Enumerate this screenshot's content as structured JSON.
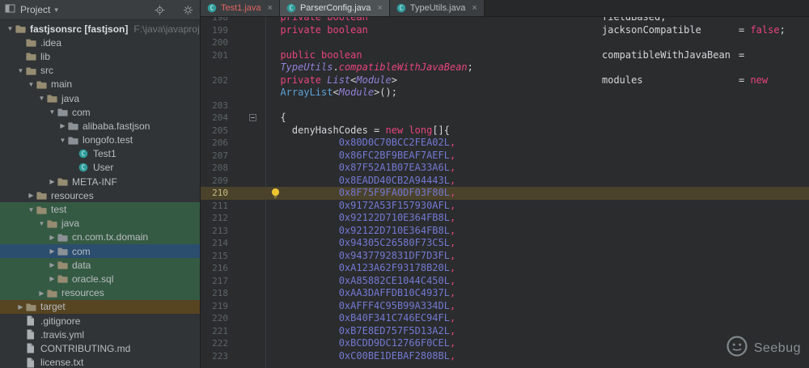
{
  "project_panel": {
    "title": "Project",
    "tool_window_icon": "project-tool-window-icon",
    "header_icons": [
      "locate-icon",
      "collapse-all-icon",
      "gear-icon"
    ],
    "tree": [
      {
        "level": 0,
        "arrow": "down",
        "icon": "folder-icon",
        "label": "fastjsonsrc [fastjson]",
        "extra": "F:\\java\\javaproject\\fastj",
        "bold": true
      },
      {
        "level": 1,
        "arrow": "",
        "icon": "folder-icon",
        "label": ".idea"
      },
      {
        "level": 1,
        "arrow": "",
        "icon": "folder-icon",
        "label": "lib"
      },
      {
        "level": 1,
        "arrow": "down",
        "icon": "folder-icon",
        "label": "src"
      },
      {
        "level": 2,
        "arrow": "down",
        "icon": "folder-icon",
        "label": "main"
      },
      {
        "level": 3,
        "arrow": "down",
        "icon": "folder-icon",
        "label": "java"
      },
      {
        "level": 4,
        "arrow": "down",
        "icon": "package-icon",
        "label": "com"
      },
      {
        "level": 5,
        "arrow": "right",
        "icon": "package-icon",
        "label": "alibaba.fastjson"
      },
      {
        "level": 5,
        "arrow": "down",
        "icon": "package-icon",
        "label": "longofo.test"
      },
      {
        "level": 6,
        "arrow": "",
        "icon": "class-icon",
        "label": "Test1"
      },
      {
        "level": 6,
        "arrow": "",
        "icon": "class-icon",
        "label": "User"
      },
      {
        "level": 4,
        "arrow": "right",
        "icon": "folder-icon",
        "label": "META-INF"
      },
      {
        "level": 2,
        "arrow": "right",
        "icon": "folder-icon",
        "label": "resources"
      },
      {
        "level": 2,
        "arrow": "down",
        "icon": "folder-icon",
        "label": "test",
        "bg": "green"
      },
      {
        "level": 3,
        "arrow": "down",
        "icon": "folder-icon",
        "label": "java",
        "bg": "green"
      },
      {
        "level": 4,
        "arrow": "right",
        "icon": "package-icon",
        "label": "cn.com.tx.domain",
        "bg": "green"
      },
      {
        "level": 4,
        "arrow": "right",
        "icon": "package-icon",
        "label": "com",
        "bg": "blue"
      },
      {
        "level": 4,
        "arrow": "right",
        "icon": "folder-icon",
        "label": "data",
        "bg": "green"
      },
      {
        "level": 4,
        "arrow": "right",
        "icon": "folder-icon",
        "label": "oracle.sql",
        "bg": "green"
      },
      {
        "level": 3,
        "arrow": "right",
        "icon": "folder-icon",
        "label": "resources",
        "bg": "green"
      },
      {
        "level": 1,
        "arrow": "right",
        "icon": "folder-icon",
        "label": "target",
        "bg": "amber"
      },
      {
        "level": 1,
        "arrow": "",
        "icon": "file-icon",
        "label": ".gitignore"
      },
      {
        "level": 1,
        "arrow": "",
        "icon": "file-icon",
        "label": ".travis.yml"
      },
      {
        "level": 1,
        "arrow": "",
        "icon": "file-icon",
        "label": "CONTRIBUTING.md"
      },
      {
        "level": 1,
        "arrow": "",
        "icon": "file-icon",
        "label": "license.txt"
      }
    ]
  },
  "editor": {
    "tabs": [
      {
        "label": "Test1.java",
        "icon": "class-icon",
        "state": "error",
        "close": "×"
      },
      {
        "label": "ParserConfig.java",
        "icon": "class-icon",
        "state": "active",
        "close": "×"
      },
      {
        "label": "TypeUtils.java",
        "icon": "class-icon",
        "state": "normal",
        "close": "×"
      }
    ],
    "lines": [
      {
        "num": "198",
        "segs": [
          [
            "  ",
            "pln"
          ],
          [
            "private boolean",
            "kw"
          ]
        ],
        "col2": [
          [
            "fieldBased;",
            "pln"
          ]
        ]
      },
      {
        "num": "199",
        "segs": [
          [
            "  ",
            "pln"
          ],
          [
            "private boolean",
            "kw"
          ]
        ],
        "col2": [
          [
            "jacksonCompatible",
            "pln"
          ]
        ],
        "col3": [
          [
            "= ",
            "pln"
          ],
          [
            "false",
            "kw"
          ],
          [
            ";",
            "pln"
          ]
        ]
      },
      {
        "num": "200",
        "segs": []
      },
      {
        "num": "201",
        "segs": [
          [
            "  ",
            "pln"
          ],
          [
            "public boolean",
            "kw"
          ]
        ],
        "col2": [
          [
            "compatibleWithJavaBean",
            "pln"
          ]
        ],
        "col3": [
          [
            "=",
            "pln"
          ]
        ]
      },
      {
        "num": "",
        "segs": [
          [
            "  ",
            "pln"
          ],
          [
            "TypeUtils",
            "typ"
          ],
          [
            ".",
            "pln"
          ],
          [
            "compatibleWithJavaBean",
            "kwi"
          ],
          [
            ";",
            "pln"
          ]
        ]
      },
      {
        "num": "202",
        "segs": [
          [
            "  ",
            "pln"
          ],
          [
            "private ",
            "kw"
          ],
          [
            "List",
            "typ"
          ],
          [
            "<",
            "pln"
          ],
          [
            "Module",
            "typ"
          ],
          [
            ">",
            "pln"
          ]
        ],
        "col2": [
          [
            "modules",
            "pln"
          ]
        ],
        "col3": [
          [
            "= ",
            "pln"
          ],
          [
            "new",
            "kw"
          ]
        ]
      },
      {
        "num": "",
        "segs": [
          [
            "  ",
            "pln"
          ],
          [
            "ArrayList",
            "cls"
          ],
          [
            "<",
            "pln"
          ],
          [
            "Module",
            "typ"
          ],
          [
            ">();",
            "pln"
          ]
        ]
      },
      {
        "num": "203",
        "segs": []
      },
      {
        "num": "204",
        "fold": true,
        "segs": [
          [
            "  {",
            "pln"
          ]
        ]
      },
      {
        "num": "205",
        "segs": [
          [
            "    ",
            "pln"
          ],
          [
            "denyHashCodes",
            "pln"
          ],
          [
            " = ",
            "pln"
          ],
          [
            "new ",
            "kw"
          ],
          [
            "long",
            "kw"
          ],
          [
            "[]{",
            "pln"
          ]
        ]
      },
      {
        "num": "206",
        "segs": [
          [
            "            ",
            "pln"
          ],
          [
            "0x80D0C70BCC2FEA02L",
            "num"
          ],
          [
            ",",
            "com"
          ]
        ]
      },
      {
        "num": "207",
        "segs": [
          [
            "            ",
            "pln"
          ],
          [
            "0x86FC2BF9BEAF7AEFL",
            "num"
          ],
          [
            ",",
            "com"
          ]
        ]
      },
      {
        "num": "208",
        "segs": [
          [
            "            ",
            "pln"
          ],
          [
            "0x87F52A1B07EA33A6L",
            "num"
          ],
          [
            ",",
            "com"
          ]
        ]
      },
      {
        "num": "209",
        "segs": [
          [
            "            ",
            "pln"
          ],
          [
            "0x8EADD40CB2A94443L",
            "num"
          ],
          [
            ",",
            "com"
          ]
        ]
      },
      {
        "num": "210",
        "hl": true,
        "bulb": true,
        "segs": [
          [
            "            ",
            "pln"
          ],
          [
            "0x8F75F9FA0DF03F80L",
            "num"
          ],
          [
            ",",
            "com"
          ]
        ]
      },
      {
        "num": "211",
        "segs": [
          [
            "            ",
            "pln"
          ],
          [
            "0x9172A53F157930AFL",
            "num"
          ],
          [
            ",",
            "com"
          ]
        ]
      },
      {
        "num": "212",
        "segs": [
          [
            "            ",
            "pln"
          ],
          [
            "0x92122D710E364FB8L",
            "num"
          ],
          [
            ",",
            "com"
          ]
        ]
      },
      {
        "num": "213",
        "segs": [
          [
            "            ",
            "pln"
          ],
          [
            "0x92122D710E364FB8L",
            "num"
          ],
          [
            ",",
            "com"
          ]
        ]
      },
      {
        "num": "214",
        "segs": [
          [
            "            ",
            "pln"
          ],
          [
            "0x94305C26580F73C5L",
            "num"
          ],
          [
            ",",
            "com"
          ]
        ]
      },
      {
        "num": "215",
        "segs": [
          [
            "            ",
            "pln"
          ],
          [
            "0x9437792831DF7D3FL",
            "num"
          ],
          [
            ",",
            "com"
          ]
        ]
      },
      {
        "num": "216",
        "segs": [
          [
            "            ",
            "pln"
          ],
          [
            "0xA123A62F93178B20L",
            "num"
          ],
          [
            ",",
            "com"
          ]
        ]
      },
      {
        "num": "217",
        "segs": [
          [
            "            ",
            "pln"
          ],
          [
            "0xA85882CE1044C450L",
            "num"
          ],
          [
            ",",
            "com"
          ]
        ]
      },
      {
        "num": "218",
        "segs": [
          [
            "            ",
            "pln"
          ],
          [
            "0xAA3DAFFDB10C4937L",
            "num"
          ],
          [
            ",",
            "com"
          ]
        ]
      },
      {
        "num": "219",
        "segs": [
          [
            "            ",
            "pln"
          ],
          [
            "0xAFFF4C95B99A334DL",
            "num"
          ],
          [
            ",",
            "com"
          ]
        ]
      },
      {
        "num": "220",
        "segs": [
          [
            "            ",
            "pln"
          ],
          [
            "0xB40F341C746EC94FL",
            "num"
          ],
          [
            ",",
            "com"
          ]
        ]
      },
      {
        "num": "221",
        "segs": [
          [
            "            ",
            "pln"
          ],
          [
            "0xB7E8ED757F5D13A2L",
            "num"
          ],
          [
            ",",
            "com"
          ]
        ]
      },
      {
        "num": "222",
        "segs": [
          [
            "            ",
            "pln"
          ],
          [
            "0xBCDD9DC12766F0CEL",
            "num"
          ],
          [
            ",",
            "com"
          ]
        ]
      },
      {
        "num": "223",
        "segs": [
          [
            "            ",
            "pln"
          ],
          [
            "0xC00BE1DEBAF2808BL",
            "num"
          ],
          [
            ",",
            "com"
          ]
        ]
      }
    ]
  },
  "watermark": {
    "label": "Seebug",
    "logo_icon": "seebug-logo-icon"
  },
  "colors": {
    "keyword_pink": "#e8447c",
    "number_violet": "#7479d2",
    "type_purple": "#9381d9",
    "class_blue": "#5da2d8",
    "editor_bg": "#2a2c2e",
    "panel_bg": "#303436",
    "caret_line_bg": "#4a422a",
    "test_scope_green_bg": "#355a43",
    "selected_row_blue_bg": "#2b4d6e",
    "excluded_amber_bg": "#574421",
    "error_tab_text": "#e0655f"
  }
}
